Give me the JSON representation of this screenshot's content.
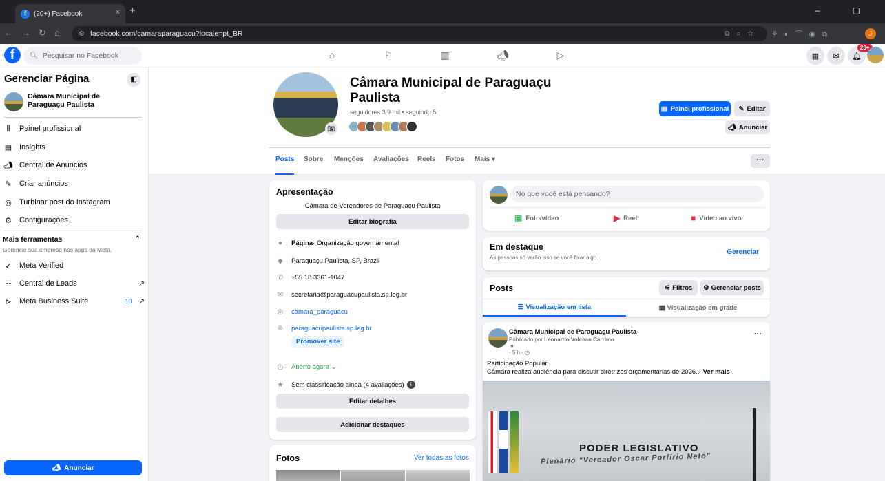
{
  "browser": {
    "tab_title": "(20+) Facebook",
    "tab_close": "×",
    "new_tab": "+",
    "url": "facebook.com/camaraparaguacu?locale=pt_BR",
    "profile_initial": "J"
  },
  "fb": {
    "search_placeholder": "Pesquisar no Facebook",
    "notif_badge": "20+"
  },
  "sidebar": {
    "title": "Gerenciar Página",
    "page_name": "Câmara Municipal de Paraguaçu Paulista",
    "items": [
      {
        "label": "Painel profissional",
        "icon": "dashboard-icon"
      },
      {
        "label": "Insights",
        "icon": "insights-icon"
      },
      {
        "label": "Central de Anúncios",
        "icon": "megaphone-icon"
      },
      {
        "label": "Criar anúncios",
        "icon": "pencil-icon"
      },
      {
        "label": "Turbinar post do Instagram",
        "icon": "instagram-icon"
      },
      {
        "label": "Configurações",
        "icon": "gear-icon"
      }
    ],
    "more_tools_title": "Mais ferramentas",
    "more_tools_sub": "Gerencie sua empresa nos apps da Meta.",
    "tools": [
      {
        "label": "Meta Verified",
        "icon": "verified-icon"
      },
      {
        "label": "Central de Leads",
        "icon": "leads-icon"
      },
      {
        "label": "Meta Business Suite",
        "icon": "business-suite-icon",
        "count": "10"
      }
    ],
    "advertise_label": "Anunciar"
  },
  "header": {
    "page_title": "Câmara Municipal de Paraguaçu Paulista",
    "followers": "seguidores 3.9 mil • seguindo 5",
    "btn_dashboard": "Painel profissional",
    "btn_edit": "Editar",
    "btn_advertise": "Anunciar",
    "tabs": [
      "Posts",
      "Sobre",
      "Menções",
      "Avaliações",
      "Reels",
      "Fotos",
      "Mais ▾"
    ],
    "more_dots": "···"
  },
  "intro": {
    "title": "Apresentação",
    "bio": "Câmara de Vereadores de Paraguaçu Paulista",
    "edit_bio": "Editar biografia",
    "page_label": "Página",
    "page_category": " · Organização governamental",
    "location": "Paraguaçu Paulista, SP, Brazil",
    "phone": "+55 18 3361-1047",
    "email": "secretaria@paraguacupaulista.sp.leg.br",
    "instagram": "camara_paraguacu",
    "website": "paraguacupaulista.sp.leg.br",
    "promote_site": "Promover site",
    "open_now": "Aberto agora ⌄",
    "rating": "Sem classificação ainda (4 avaliações)",
    "edit_details": "Editar detalhes",
    "add_highlights": "Adicionar destaques"
  },
  "photos": {
    "title": "Fotos",
    "see_all": "Ver todas as fotos"
  },
  "composer": {
    "placeholder": "No que você está pensando?",
    "photo_video": "Foto/vídeo",
    "reel": "Reel",
    "live": "Vídeo ao vivo"
  },
  "highlights": {
    "title": "Em destaque",
    "sub": "As pessoas só verão isso se você fixar algo.",
    "manage": "Gerenciar"
  },
  "posts_section": {
    "title": "Posts",
    "filters": "Filtros",
    "manage_posts": "Gerenciar posts",
    "list_view": "Visualização em lista",
    "grid_view": "Visualização em grade"
  },
  "post": {
    "author": "Câmara Municipal de Paraguaçu Paulista",
    "published_by_prefix": "Publicado por ",
    "published_by": "Leonardo Volcean Carreno",
    "time": "· 5 h · ◷",
    "text_line1": "Participação Popular",
    "text_line2": "Câmara realiza audiência para discutir diretrizes orçamentárias de 2026... ",
    "see_more": "Ver mais",
    "dots": "···",
    "image_text1": "PODER LEGISLATIVO",
    "image_text2": "Plenário \"Vereador Oscar Porfírio Neto\""
  },
  "colors": {
    "fb_blue": "#0866ff",
    "bg": "#f0f2f5"
  }
}
